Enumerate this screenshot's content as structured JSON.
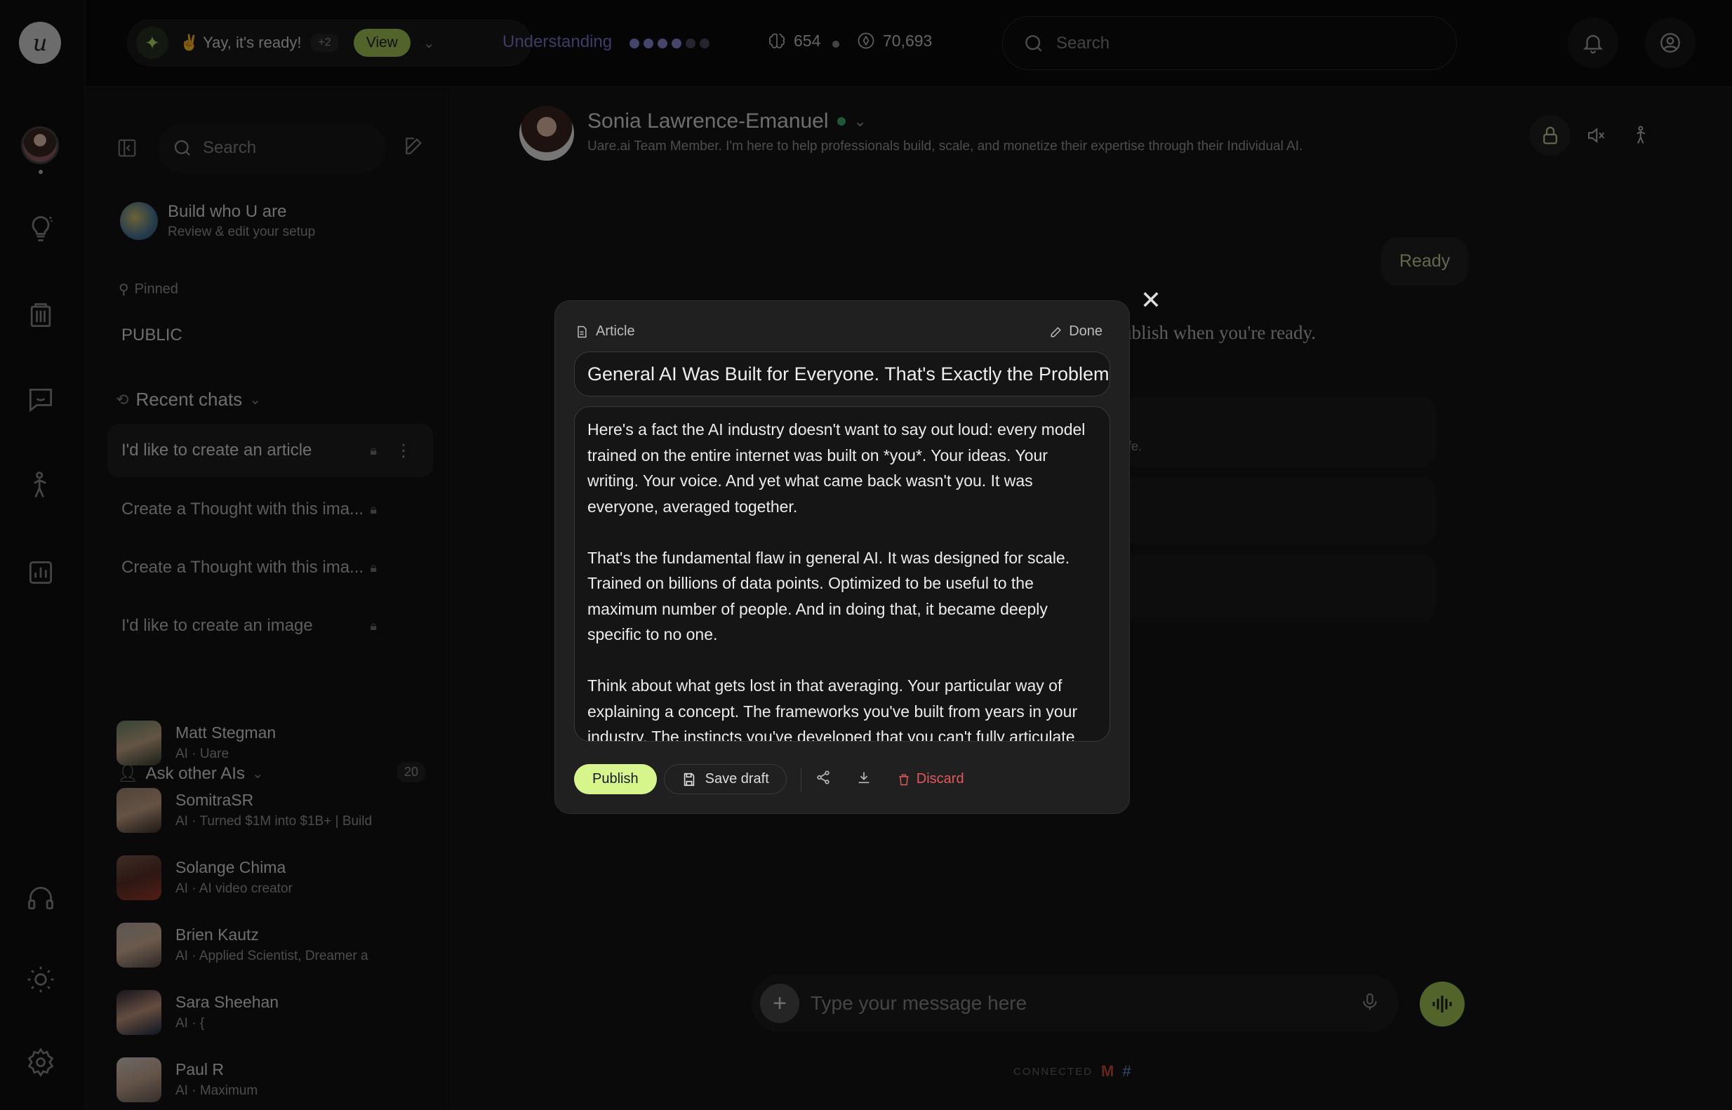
{
  "topbar": {
    "ready_text": "✌️ Yay, it's ready!",
    "ready_count": "+2",
    "view_label": "View",
    "understanding_label": "Understanding",
    "understanding_level": 4,
    "understanding_max": 6,
    "stat_memories": "654",
    "stat_credits": "70,693",
    "search_placeholder": "Search"
  },
  "sidebar": {
    "search_placeholder": "Search",
    "build_title": "Build who U are",
    "build_subtitle": "Review & edit your setup",
    "pinned_label": "Pinned",
    "public_label": "PUBLIC",
    "recent_label": "Recent chats",
    "chats": [
      {
        "label": "I'd like to create an article"
      },
      {
        "label": "Create a Thought with this ima..."
      },
      {
        "label": "Create a Thought with this ima..."
      },
      {
        "label": "I'd like to create an image"
      }
    ],
    "ask_label": "Ask other AIs",
    "ask_count": "20",
    "people": [
      {
        "name": "Matt Stegman",
        "sub": "AI · Uare"
      },
      {
        "name": "SomitraSR",
        "sub": "AI · Turned $1M into $1B+ | Build"
      },
      {
        "name": "Solange Chima",
        "sub": "AI · AI video creator"
      },
      {
        "name": "Brien Kautz",
        "sub": "AI · Applied Scientist, Dreamer a"
      },
      {
        "name": "Sara Sheehan",
        "sub": "AI · {"
      },
      {
        "name": "Paul R",
        "sub": "AI · Maximum"
      }
    ]
  },
  "agent": {
    "name": "Sonia Lawrence-Emanuel",
    "description": "Uare.ai Team Member. I'm here to help professionals build, scale, and monetize their expertise through their Individual AI."
  },
  "chat": {
    "ready_bubble": "Ready",
    "bg_text": "ublish when you're ready.",
    "bg_card_small": "life.",
    "input_placeholder": "Type your message here",
    "connected_label": "CONNECTED"
  },
  "modal": {
    "tag": "Article",
    "done_label": "Done",
    "title": "General AI Was Built for Everyone. That's Exactly the Problem",
    "paragraphs": [
      "Here's a fact the AI industry doesn't want to say out loud: every model trained on the entire internet was built on *you*. Your ideas. Your writing. Your voice. And yet what came back wasn't you. It was everyone, averaged together.",
      "That's the fundamental flaw in general AI. It was designed for scale. Trained on billions of data points. Optimized to be useful to the maximum number of people. And in doing that, it became deeply specific to no one.",
      "Think about what gets lost in that averaging. Your particular way of explaining a concept. The frameworks you've built from years in your industry. The instincts you've developed that you can't fully articulate"
    ],
    "publish_label": "Publish",
    "save_draft_label": "Save draft",
    "discard_label": "Discard"
  },
  "colors": {
    "accent_green": "#a7c957",
    "publish_green": "#d6f58a",
    "understanding_purple": "#7a79c9",
    "discard_red": "#e05a5a",
    "online_green": "#3db36f"
  }
}
